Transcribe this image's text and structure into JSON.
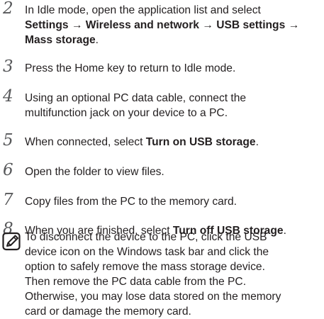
{
  "steps": [
    {
      "number": "2",
      "lines": [
        [
          {
            "t": "In Idle mode, open the application list and select",
            "b": false
          }
        ],
        [
          {
            "t": "Settings → Wireless and network → USB settings →",
            "b": true
          }
        ],
        [
          {
            "t": "Mass storage",
            "b": true
          },
          {
            "t": ".",
            "b": false
          }
        ]
      ]
    },
    {
      "number": "3",
      "lines": [
        [
          {
            "t": "Press the Home key to return to Idle mode.",
            "b": false
          }
        ]
      ]
    },
    {
      "number": "4",
      "lines": [
        [
          {
            "t": "Using an optional PC data cable, connect the",
            "b": false
          }
        ],
        [
          {
            "t": "multifunction jack on your device to a PC.",
            "b": false
          }
        ]
      ]
    },
    {
      "number": "5",
      "lines": [
        [
          {
            "t": "When connected, select ",
            "b": false
          },
          {
            "t": "Turn on USB storage",
            "b": true
          },
          {
            "t": ".",
            "b": false
          }
        ]
      ]
    },
    {
      "number": "6",
      "lines": [
        [
          {
            "t": "Open the folder to view files.",
            "b": false
          }
        ]
      ]
    },
    {
      "number": "7",
      "lines": [
        [
          {
            "t": "Copy files from the PC to the memory card.",
            "b": false
          }
        ]
      ]
    },
    {
      "number": "8",
      "lines": [
        [
          {
            "t": "When you are finished, select ",
            "b": false
          },
          {
            "t": "Turn off USB storage",
            "b": true
          },
          {
            "t": ".",
            "b": false
          }
        ]
      ]
    }
  ],
  "note": {
    "icon": "note-pencil-icon",
    "lines": [
      "To disconnect the device to the PC, click the USB",
      "device icon on the Windows task bar and click the",
      "option to safely remove the mass storage device.",
      "Then remove the PC data cable from the PC.",
      "Otherwise, you may lose data stored on the memory",
      "card or damage the memory card."
    ]
  }
}
